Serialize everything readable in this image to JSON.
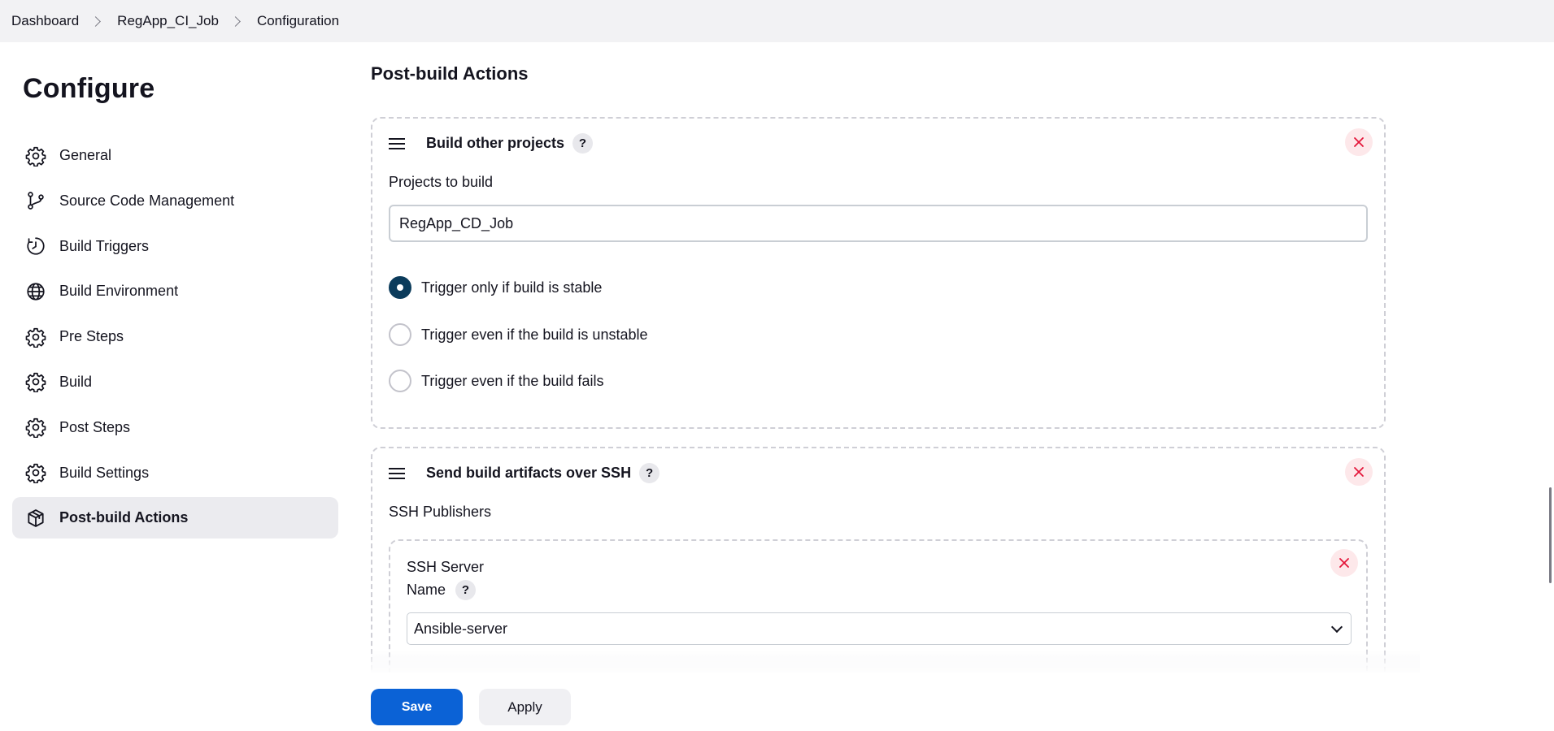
{
  "breadcrumb": {
    "items": [
      "Dashboard",
      "RegApp_CI_Job",
      "Configuration"
    ]
  },
  "sidebar": {
    "title": "Configure",
    "items": [
      {
        "label": "General",
        "icon": "gear-icon"
      },
      {
        "label": "Source Code Management",
        "icon": "branch-icon"
      },
      {
        "label": "Build Triggers",
        "icon": "clock-icon"
      },
      {
        "label": "Build Environment",
        "icon": "globe-icon"
      },
      {
        "label": "Pre Steps",
        "icon": "gear-icon"
      },
      {
        "label": "Build",
        "icon": "gear-icon"
      },
      {
        "label": "Post Steps",
        "icon": "gear-icon"
      },
      {
        "label": "Build Settings",
        "icon": "gear-icon"
      },
      {
        "label": "Post-build Actions",
        "icon": "package-icon",
        "active": true
      }
    ]
  },
  "main": {
    "section_title": "Post-build Actions",
    "build_other_projects": {
      "title": "Build other projects",
      "help": "?",
      "projects_label": "Projects to build",
      "projects_value": "RegApp_CD_Job",
      "options": [
        {
          "label": "Trigger only if build is stable",
          "checked": true
        },
        {
          "label": "Trigger even if the build is unstable",
          "checked": false
        },
        {
          "label": "Trigger even if the build fails",
          "checked": false
        }
      ]
    },
    "send_artifacts_ssh": {
      "title": "Send build artifacts over SSH",
      "help": "?",
      "publishers_label": "SSH Publishers",
      "server": {
        "heading": "SSH Server",
        "name_label": "Name",
        "help": "?",
        "selected": "Ansible-server"
      }
    }
  },
  "actions": {
    "save_label": "Save",
    "apply_label": "Apply"
  },
  "colors": {
    "accent": "#0b62d6",
    "radio_checked": "#0b3b5b",
    "close_bg": "#fde8ea",
    "close_x": "#e4163a"
  }
}
